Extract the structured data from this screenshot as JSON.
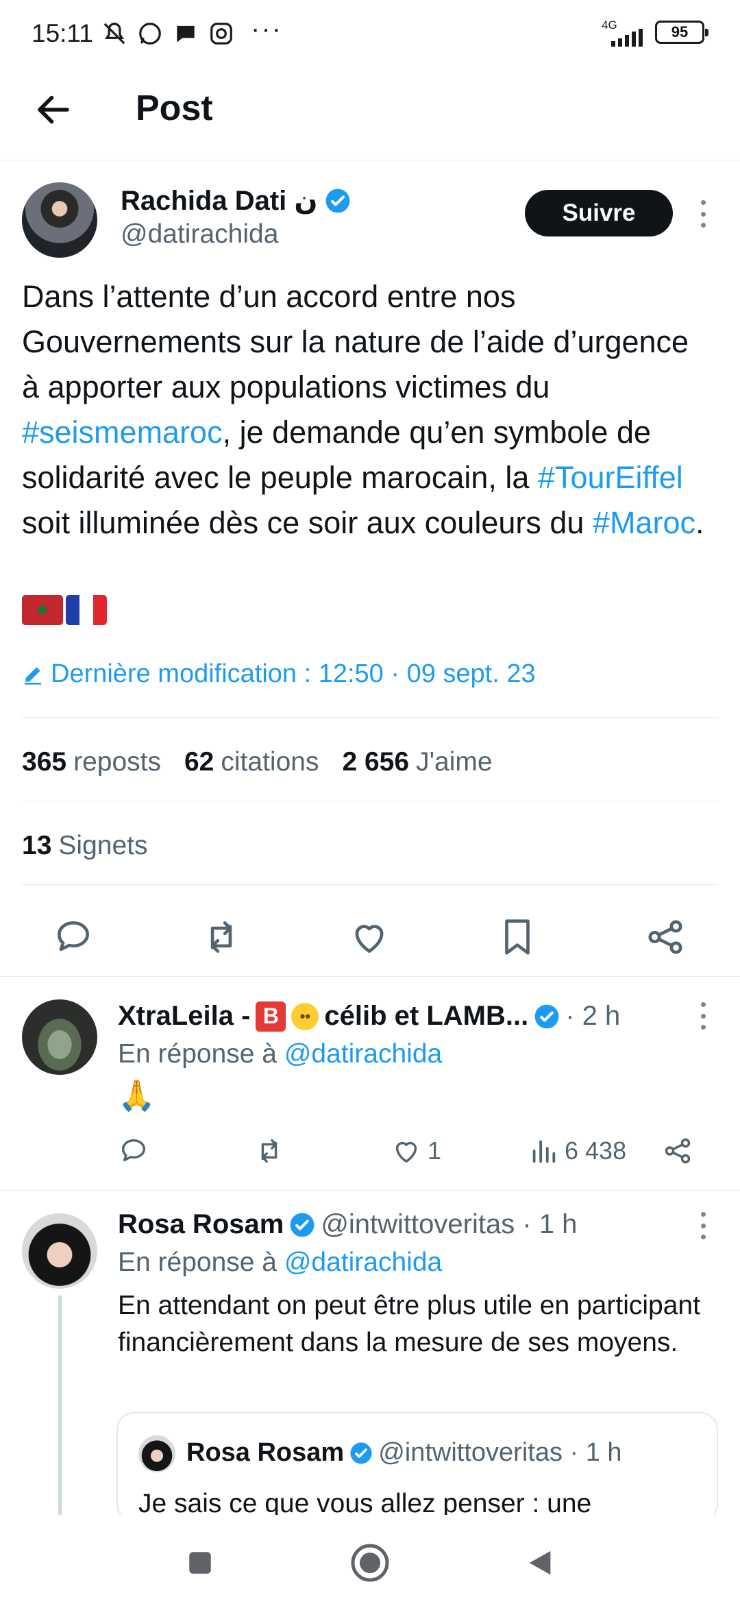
{
  "status_bar": {
    "time": "15:11",
    "more": "···",
    "network": "4G",
    "battery": "95"
  },
  "header": {
    "title": "Post"
  },
  "post": {
    "author_name": "Rachida Dati ن",
    "author_handle": "@datirachida",
    "follow_label": "Suivre",
    "text_parts": {
      "p1": "Dans l’attente d’un accord entre nos Gouvernements sur la nature de l’aide d’urgence à apporter aux populations victimes du ",
      "h1": "#seismemaroc",
      "p2": ", je demande qu’en symbole de solidarité avec le peuple marocain, la ",
      "h2": "#TourEiffel",
      "p3": " soit illuminée dès ce soir aux couleurs du ",
      "h3": "#Maroc",
      "p4": "."
    },
    "edited": "Dernière modification : 12:50 · 09 sept. 23",
    "stats": {
      "reposts_count": "365",
      "reposts_label": "reposts",
      "quotes_count": "62",
      "quotes_label": "citations",
      "likes_count": "2 656",
      "likes_label": "J'aime",
      "bookmarks_count": "13",
      "bookmarks_label": "Signets"
    }
  },
  "replies": [
    {
      "name": "XtraLeila - ",
      "name_tail": " célib et LAMB...",
      "meta": "· 2 h",
      "in_reply_label": "En réponse à ",
      "in_reply_mention": "@datirachida",
      "text": "🙏",
      "likes": "1",
      "views": "6 438"
    },
    {
      "name": "Rosa Rosam",
      "meta": "@intwittoveritas · 1 h",
      "in_reply_label": "En réponse à ",
      "in_reply_mention": "@datirachida",
      "text": "En attendant on peut être plus utile en participant financièrement dans la mesure de ses moyens.",
      "quote": {
        "name": "Rosa Rosam",
        "meta": "@intwittoveritas · 1 h",
        "text": "Je sais ce que vous allez penser : une"
      }
    }
  ],
  "colors": {
    "accent": "#1d9bf0",
    "text": "#0f1419",
    "muted": "#536471"
  }
}
